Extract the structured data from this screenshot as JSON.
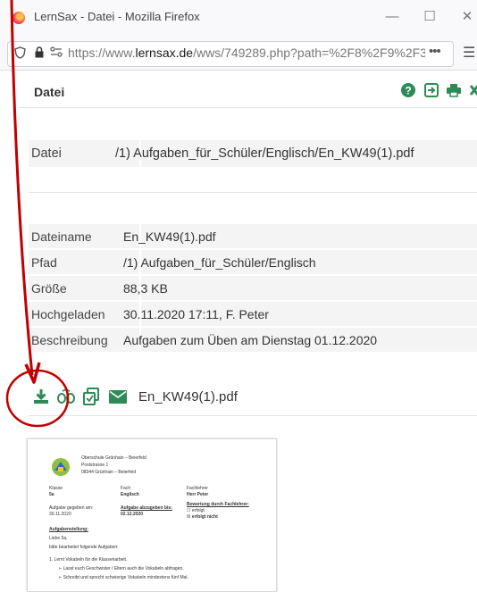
{
  "window": {
    "title": "LernSax - Datei - Mozilla Firefox",
    "minimize": "—",
    "maximize": "☐",
    "close": "✕"
  },
  "urlbar": {
    "url_prefix": "https://www.",
    "url_domain": "lernsax.de",
    "url_rest": "/wws/749289.php?path=%2F8%2F9%2F3",
    "more": "•••",
    "menu": "☰"
  },
  "header": {
    "title": "Datei"
  },
  "path_row": {
    "label": "Datei",
    "value": "/1) Aufgaben_für_Schüler/Englisch/En_KW49(1).pdf"
  },
  "details": [
    {
      "label": "Dateiname",
      "value": "En_KW49(1).pdf"
    },
    {
      "label": "Pfad",
      "value": "/1) Aufgaben_für_Schüler/Englisch"
    },
    {
      "label": "Größe",
      "value": "88,3 KB"
    },
    {
      "label": "Hochgeladen",
      "value": "30.11.2020 17:11, F. Peter"
    },
    {
      "label": "Beschreibung",
      "value": "Aufgaben zum Üben am Dienstag 01.12.2020"
    }
  ],
  "file_actions": {
    "filename": "En_KW49(1).pdf"
  },
  "preview": {
    "school_line1": "Oberschule Grünhain – Beierfeld",
    "school_line2": "Poststrasse 1",
    "school_line3": "08344 Grünhain – Beierfeld",
    "col_klasse": "Klasse",
    "col_fach": "Fach",
    "col_fachlehrer": "Fachlehrer",
    "val_klasse": "5a",
    "val_fach": "Englisch",
    "val_fachlehrer": "Herr Peter",
    "given_label": "Aufgabe gegeben am:",
    "given_date": "30.11.2020",
    "due_label": "Aufgabe abzugeben bis:",
    "due_date": "02.12.2020",
    "eval_label": "Bewertung durch Fachlehrer:",
    "eval_opt1": "☐ erfolgt",
    "eval_opt2": "☒ erfolgt nicht",
    "task_heading": "Aufgabenstellung:",
    "greeting": "Liebe 5a,",
    "intro": "bitte bearbeitet folgende Aufgaben:",
    "task1": "1. Lernt Vokabeln für die Klassenarbeit.",
    "bullet1": "➢  Lasst euch Geschwister / Eltern auch die Vokabeln abfragen.",
    "bullet2": "➢  Schreibt und sprecht schwierige Vokabeln mindestens fünf Mal."
  },
  "colors": {
    "annotation": "#c00000",
    "icon_green": "#2e8b57"
  }
}
